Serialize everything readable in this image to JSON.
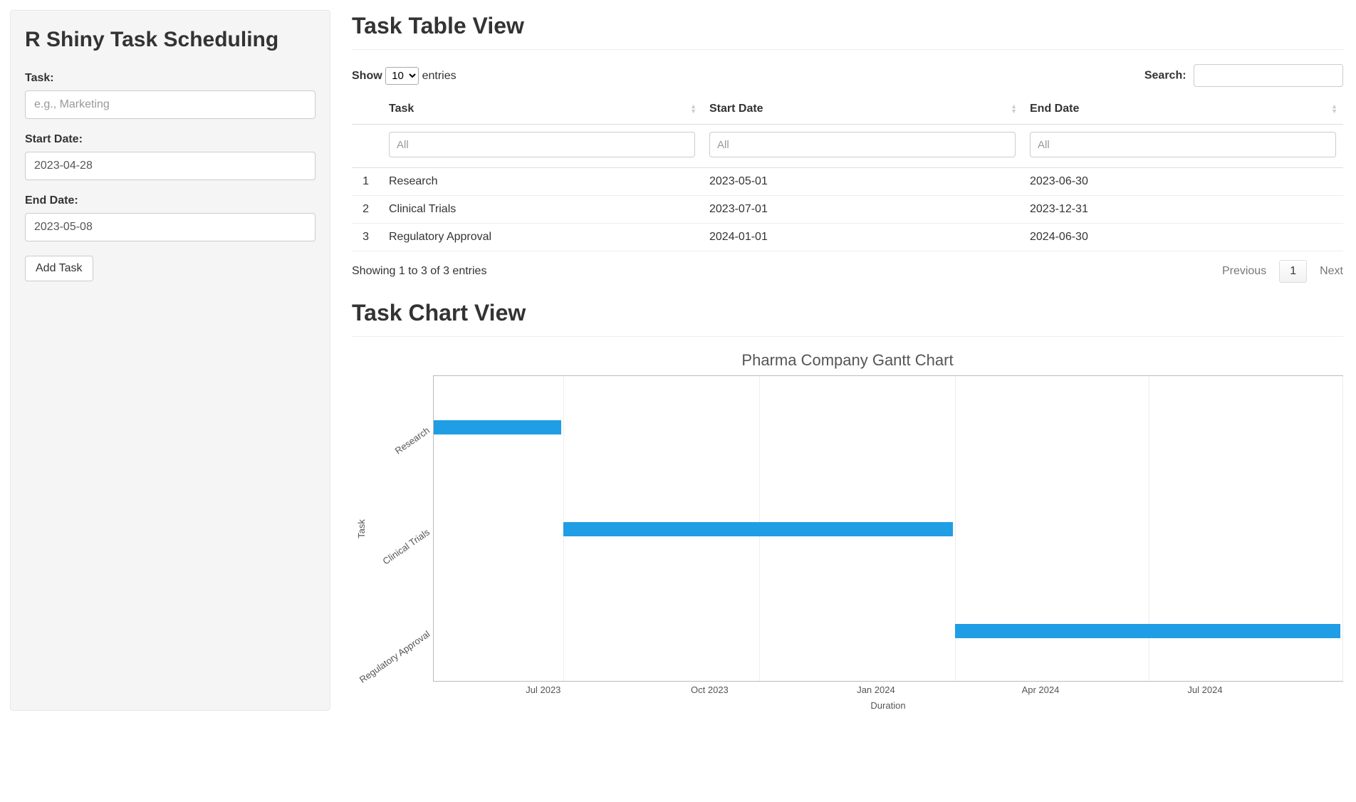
{
  "sidebar": {
    "title": "R Shiny Task Scheduling",
    "task_label": "Task:",
    "task_placeholder": "e.g., Marketing",
    "task_value": "",
    "start_label": "Start Date:",
    "start_value": "2023-04-28",
    "end_label": "End Date:",
    "end_value": "2023-05-08",
    "add_button": "Add Task"
  },
  "table_view": {
    "heading": "Task Table View",
    "show_label_pre": "Show",
    "show_label_post": "entries",
    "length_value": "10",
    "search_label": "Search:",
    "search_value": "",
    "columns": {
      "task": "Task",
      "start": "Start Date",
      "end": "End Date"
    },
    "filter_placeholder": "All",
    "rows": [
      {
        "idx": "1",
        "task": "Research",
        "start": "2023-05-01",
        "end": "2023-06-30"
      },
      {
        "idx": "2",
        "task": "Clinical Trials",
        "start": "2023-07-01",
        "end": "2023-12-31"
      },
      {
        "idx": "3",
        "task": "Regulatory Approval",
        "start": "2024-01-01",
        "end": "2024-06-30"
      }
    ],
    "info": "Showing 1 to 3 of 3 entries",
    "prev": "Previous",
    "page": "1",
    "next": "Next"
  },
  "chart_view": {
    "heading": "Task Chart View"
  },
  "chart_data": {
    "type": "bar",
    "orientation": "horizontal-gantt",
    "title": "Pharma Company Gantt Chart",
    "xlabel": "Duration",
    "ylabel": "Task",
    "x_range": [
      "2023-05-01",
      "2024-07-01"
    ],
    "x_ticks": [
      "Jul 2023",
      "Oct 2023",
      "Jan 2024",
      "Apr 2024",
      "Jul 2024"
    ],
    "x_tick_dates": [
      "2023-07-01",
      "2023-10-01",
      "2024-01-01",
      "2024-04-01",
      "2024-07-01"
    ],
    "categories": [
      "Research",
      "Clinical Trials",
      "Regulatory Approval"
    ],
    "series": [
      {
        "name": "Research",
        "start": "2023-05-01",
        "end": "2023-06-30"
      },
      {
        "name": "Clinical Trials",
        "start": "2023-07-01",
        "end": "2023-12-31"
      },
      {
        "name": "Regulatory Approval",
        "start": "2024-01-01",
        "end": "2024-06-30"
      }
    ],
    "bar_color": "#1f9ee6"
  }
}
